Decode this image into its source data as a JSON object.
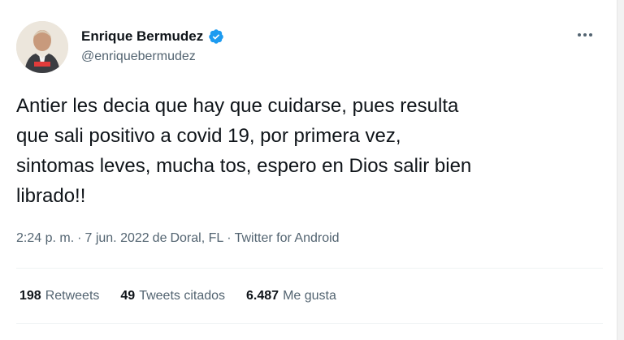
{
  "user": {
    "display_name": "Enrique Bermudez",
    "handle": "@enriquebermudez",
    "verified": true,
    "avatar_icon": "person-avatar-icon"
  },
  "tweet": {
    "text": "Antier les decia que hay que cuidarse, pues resulta\nque sali positivo a covid 19, por primera vez,\nsintomas leves, mucha tos, espero en Dios salir bien\nlibrado!!"
  },
  "meta": {
    "time": "2:24 p. m.",
    "sep1": "·",
    "date": "7 jun. 2022",
    "from_label": "de",
    "location": "Doral, FL",
    "sep2": "·",
    "source": "Twitter for Android"
  },
  "stats": {
    "retweets_count": "198",
    "retweets_label": "Retweets",
    "quotes_count": "49",
    "quotes_label": "Tweets citados",
    "likes_count": "6.487",
    "likes_label": "Me gusta"
  },
  "colors": {
    "verified": "#1d9bf0",
    "secondary_text": "#536471",
    "primary_text": "#0f1419"
  }
}
